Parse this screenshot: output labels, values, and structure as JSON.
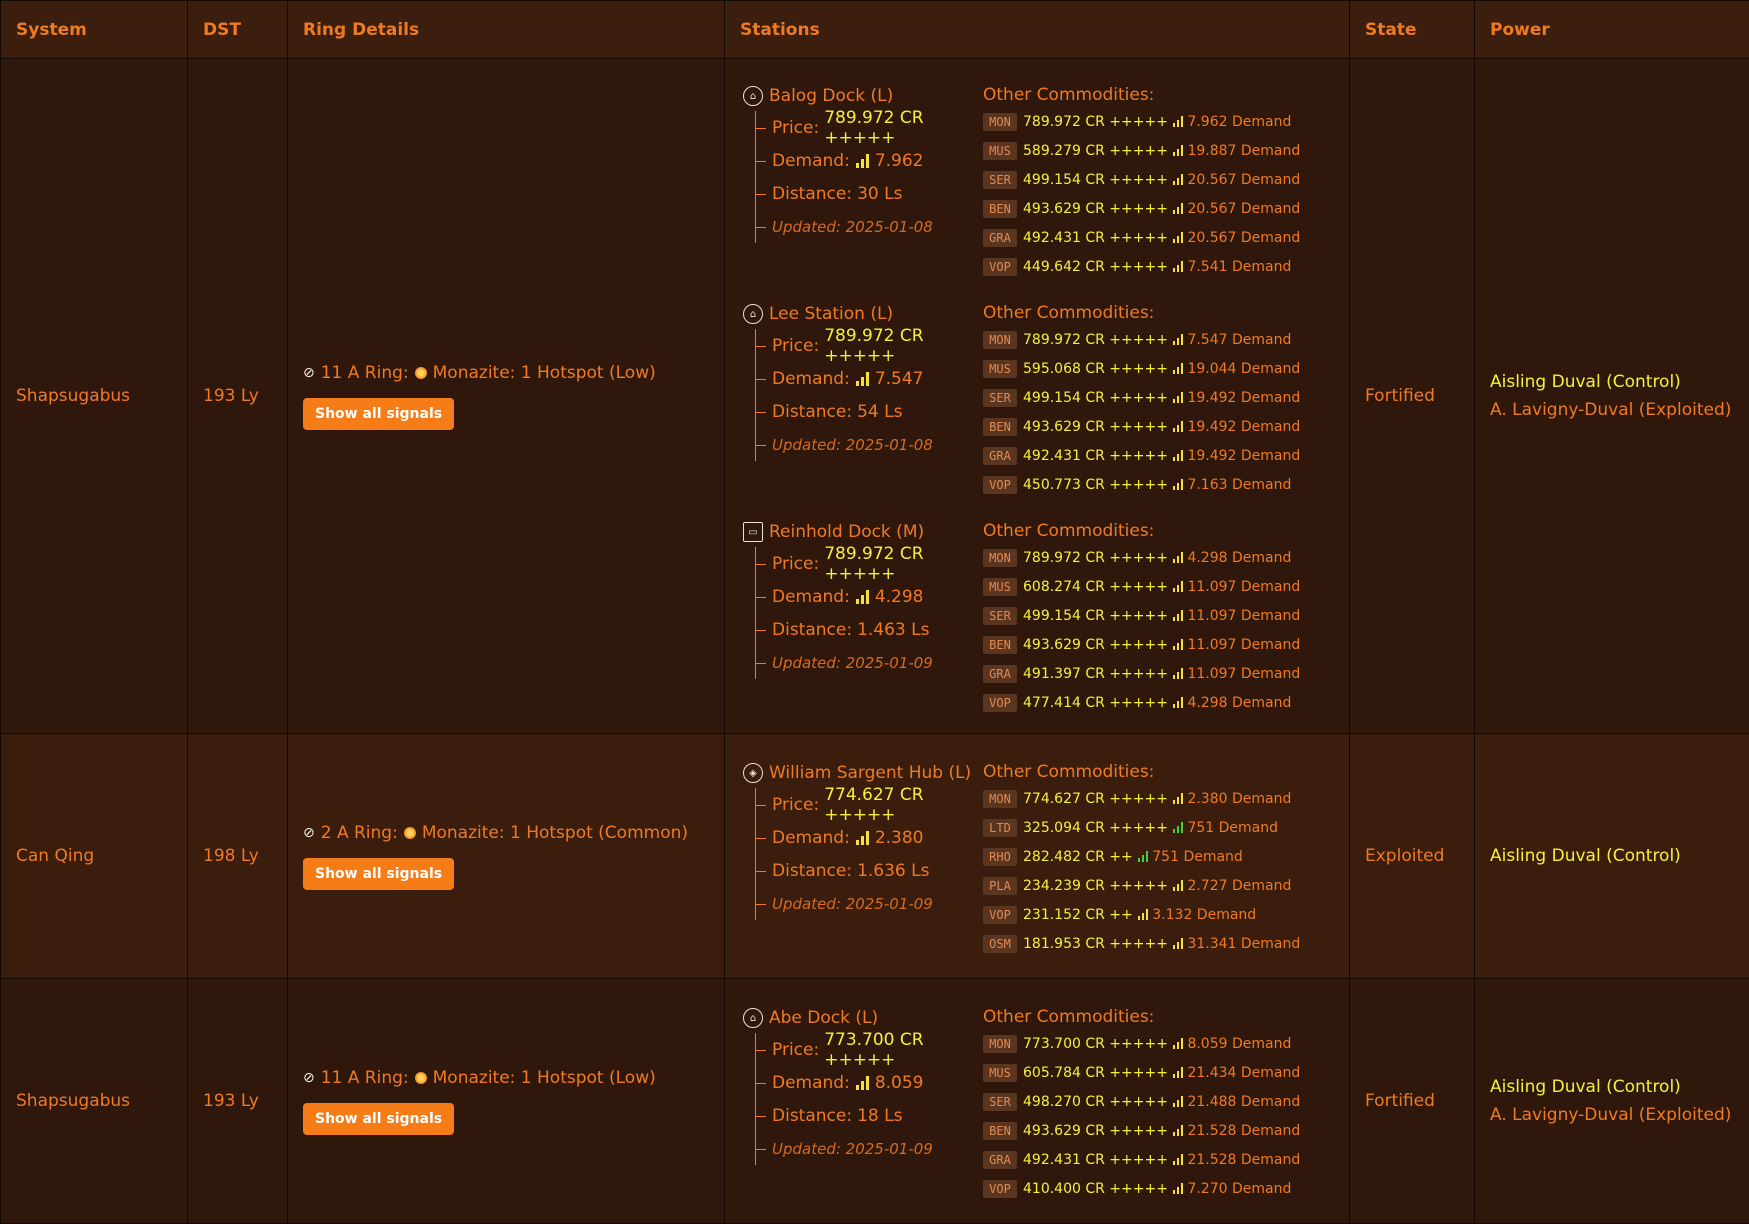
{
  "headers": {
    "system": "System",
    "dst": "DST",
    "ring": "Ring Details",
    "stations": "Stations",
    "state": "State",
    "power": "Power"
  },
  "labels": {
    "price": "Price:",
    "demand": "Demand:",
    "distance": "Distance:",
    "other": "Other Commodities:",
    "show_all": "Show all signals"
  },
  "rows": [
    {
      "system": "Shapsugabus",
      "dst": "193 Ly",
      "ring": {
        "name": "11 A Ring:",
        "hotspot": "Monazite: 1 Hotspot (Low)"
      },
      "state": "Fortified",
      "power": {
        "control": "Aisling Duval (Control)",
        "exploited": "A. Lavigny-Duval (Exploited)"
      },
      "stations": [
        {
          "name": "Balog Dock (L)",
          "icon": "outpost-icon",
          "price": "789.972 CR +++++",
          "demand": "7.962",
          "distance": "30 Ls",
          "updated": "Updated: 2025-01-08",
          "commodities": [
            {
              "code": "MON",
              "price": "789.972 CR +++++",
              "demand": "7.962 Demand"
            },
            {
              "code": "MUS",
              "price": "589.279 CR +++++",
              "demand": "19.887 Demand"
            },
            {
              "code": "SER",
              "price": "499.154 CR +++++",
              "demand": "20.567 Demand"
            },
            {
              "code": "BEN",
              "price": "493.629 CR +++++",
              "demand": "20.567 Demand"
            },
            {
              "code": "GRA",
              "price": "492.431 CR +++++",
              "demand": "20.567 Demand"
            },
            {
              "code": "VOP",
              "price": "449.642 CR +++++",
              "demand": "7.541 Demand"
            }
          ]
        },
        {
          "name": "Lee Station (L)",
          "icon": "outpost-icon",
          "price": "789.972 CR +++++",
          "demand": "7.547",
          "distance": "54 Ls",
          "updated": "Updated: 2025-01-08",
          "commodities": [
            {
              "code": "MON",
              "price": "789.972 CR +++++",
              "demand": "7.547 Demand"
            },
            {
              "code": "MUS",
              "price": "595.068 CR +++++",
              "demand": "19.044 Demand"
            },
            {
              "code": "SER",
              "price": "499.154 CR +++++",
              "demand": "19.492 Demand"
            },
            {
              "code": "BEN",
              "price": "493.629 CR +++++",
              "demand": "19.492 Demand"
            },
            {
              "code": "GRA",
              "price": "492.431 CR +++++",
              "demand": "19.492 Demand"
            },
            {
              "code": "VOP",
              "price": "450.773 CR +++++",
              "demand": "7.163 Demand"
            }
          ]
        },
        {
          "name": "Reinhold Dock (M)",
          "icon": "settlement-icon",
          "price": "789.972 CR +++++",
          "demand": "4.298",
          "distance": "1.463 Ls",
          "updated": "Updated: 2025-01-09",
          "commodities": [
            {
              "code": "MON",
              "price": "789.972 CR +++++",
              "demand": "4.298 Demand"
            },
            {
              "code": "MUS",
              "price": "608.274 CR +++++",
              "demand": "11.097 Demand"
            },
            {
              "code": "SER",
              "price": "499.154 CR +++++",
              "demand": "11.097 Demand"
            },
            {
              "code": "BEN",
              "price": "493.629 CR +++++",
              "demand": "11.097 Demand"
            },
            {
              "code": "GRA",
              "price": "491.397 CR +++++",
              "demand": "11.097 Demand"
            },
            {
              "code": "VOP",
              "price": "477.414 CR +++++",
              "demand": "4.298 Demand"
            }
          ]
        }
      ]
    },
    {
      "system": "Can Qing",
      "dst": "198 Ly",
      "ring": {
        "name": "2 A Ring:",
        "hotspot": "Monazite: 1 Hotspot (Common)"
      },
      "state": "Exploited",
      "power": {
        "control": "Aisling Duval (Control)",
        "exploited": ""
      },
      "stations": [
        {
          "name": "William Sargent Hub (L)",
          "icon": "starport-icon",
          "price": "774.627 CR +++++",
          "demand": "2.380",
          "distance": "1.636 Ls",
          "updated": "Updated: 2025-01-09",
          "commodities": [
            {
              "code": "MON",
              "price": "774.627 CR +++++",
              "demand": "2.380 Demand"
            },
            {
              "code": "LTD",
              "price": "325.094 CR +++++",
              "demand": "751 Demand",
              "green": true
            },
            {
              "code": "RHO",
              "price": "282.482 CR ++",
              "demand": "751 Demand",
              "green": true
            },
            {
              "code": "PLA",
              "price": "234.239 CR +++++",
              "demand": "2.727 Demand"
            },
            {
              "code": "VOP",
              "price": "231.152 CR ++",
              "demand": "3.132 Demand"
            },
            {
              "code": "OSM",
              "price": "181.953 CR +++++",
              "demand": "31.341 Demand"
            }
          ]
        }
      ]
    },
    {
      "system": "Shapsugabus",
      "dst": "193 Ly",
      "ring": {
        "name": "11 A Ring:",
        "hotspot": "Monazite: 1 Hotspot (Low)"
      },
      "state": "Fortified",
      "power": {
        "control": "Aisling Duval (Control)",
        "exploited": "A. Lavigny-Duval (Exploited)"
      },
      "stations": [
        {
          "name": "Abe Dock (L)",
          "icon": "outpost-icon",
          "price": "773.700 CR +++++",
          "demand": "8.059",
          "distance": "18 Ls",
          "updated": "Updated: 2025-01-09",
          "commodities": [
            {
              "code": "MON",
              "price": "773.700 CR +++++",
              "demand": "8.059 Demand"
            },
            {
              "code": "MUS",
              "price": "605.784 CR +++++",
              "demand": "21.434 Demand"
            },
            {
              "code": "SER",
              "price": "498.270 CR +++++",
              "demand": "21.488 Demand"
            },
            {
              "code": "BEN",
              "price": "493.629 CR +++++",
              "demand": "21.528 Demand"
            },
            {
              "code": "GRA",
              "price": "492.431 CR +++++",
              "demand": "21.528 Demand"
            },
            {
              "code": "VOP",
              "price": "410.400 CR +++++",
              "demand": "7.270 Demand"
            }
          ]
        }
      ]
    }
  ]
}
